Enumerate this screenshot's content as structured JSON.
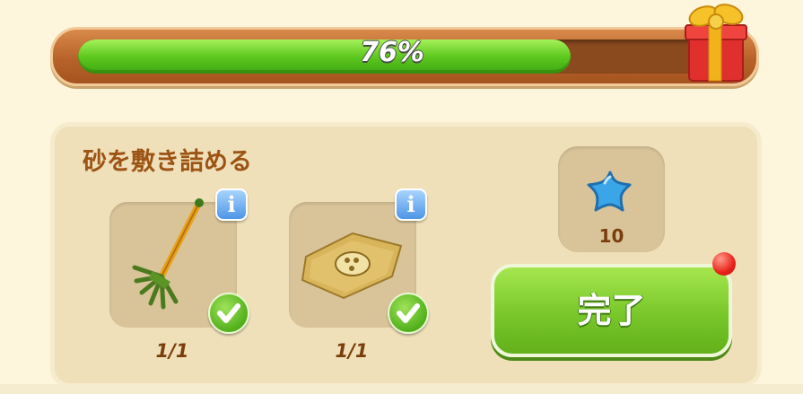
{
  "progress": {
    "value": 0.76,
    "label": "76%"
  },
  "gift": {
    "icon": "gift-box-icon"
  },
  "task": {
    "title": "砂を敷き詰める",
    "items": [
      {
        "icon": "rake-icon",
        "info": "i",
        "count": "1/1",
        "completed": true
      },
      {
        "icon": "sand-sheet-icon",
        "info": "i",
        "count": "1/1",
        "completed": true
      }
    ],
    "reward": {
      "icon": "blue-star-icon",
      "count": "10"
    },
    "complete_label": "完了"
  },
  "colors": {
    "progress_fill": "#5ec91f",
    "panel_bg": "#efe0ba",
    "title": "#9c5414",
    "button": "#78c72a",
    "notification": "#e8231a"
  }
}
